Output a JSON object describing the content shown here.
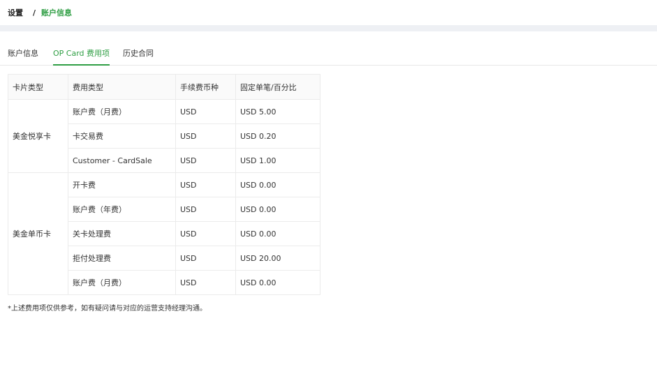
{
  "breadcrumb": {
    "root": "设置",
    "separator": "/",
    "current": "账户信息"
  },
  "tabs": [
    {
      "label": "账户信息",
      "active": false
    },
    {
      "label": "OP Card 费用项",
      "active": true
    },
    {
      "label": "历史合同",
      "active": false
    }
  ],
  "table": {
    "headers": [
      "卡片类型",
      "费用类型",
      "手续费币种",
      "固定单笔/百分比"
    ],
    "groups": [
      {
        "card_type": "美金悦享卡",
        "rows": [
          {
            "fee_type": "账户费（月费）",
            "currency": "USD",
            "amount": "USD 5.00"
          },
          {
            "fee_type": "卡交易费",
            "currency": "USD",
            "amount": "USD 0.20"
          },
          {
            "fee_type": "Customer - CardSale",
            "currency": "USD",
            "amount": "USD 1.00"
          }
        ]
      },
      {
        "card_type": "美金单币卡",
        "rows": [
          {
            "fee_type": "开卡费",
            "currency": "USD",
            "amount": "USD 0.00"
          },
          {
            "fee_type": "账户费（年费）",
            "currency": "USD",
            "amount": "USD 0.00"
          },
          {
            "fee_type": "关卡处理费",
            "currency": "USD",
            "amount": "USD 0.00"
          },
          {
            "fee_type": "拒付处理费",
            "currency": "USD",
            "amount": "USD 20.00"
          },
          {
            "fee_type": "账户费（月费）",
            "currency": "USD",
            "amount": "USD 0.00"
          }
        ]
      }
    ]
  },
  "note": "*上述费用项仅供参考，如有疑问请与对应的运营支持经理沟通。",
  "colors": {
    "accent": "#2f9e44",
    "band": "#eef0f4",
    "border": "#ebebeb"
  }
}
